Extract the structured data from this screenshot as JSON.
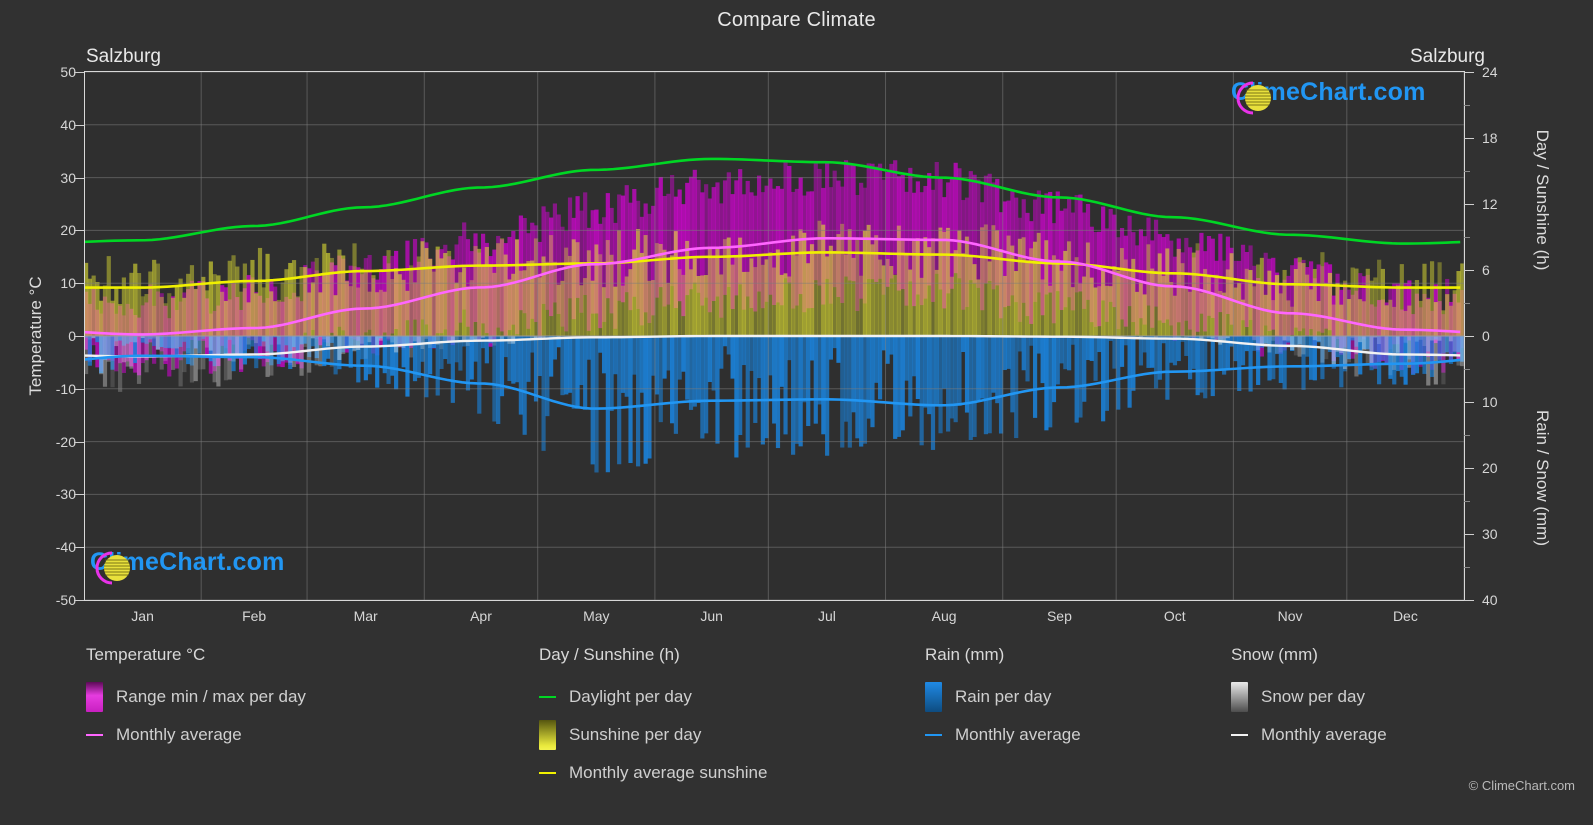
{
  "header": {
    "title": "Compare Climate",
    "location_left": "Salzburg",
    "location_right": "Salzburg"
  },
  "watermark": {
    "text": "ClimeChart.com",
    "brand_blue": "#2196f3",
    "ring_color": "#e832e8",
    "globe_color": "#e8e03c"
  },
  "copyright": "© ClimeChart.com",
  "axes": {
    "left_label": "Temperature °C",
    "right_label_top": "Day / Sunshine (h)",
    "right_label_bottom": "Rain / Snow (mm)",
    "left_ticks": [
      "50",
      "40",
      "30",
      "20",
      "10",
      "0",
      "-10",
      "-20",
      "-30",
      "-40",
      "-50"
    ],
    "right_ticks_top": [
      "24",
      "18",
      "12",
      "6",
      "0"
    ],
    "right_ticks_bottom": [
      "10",
      "20",
      "30",
      "40"
    ],
    "x_ticks": [
      "Jan",
      "Feb",
      "Mar",
      "Apr",
      "May",
      "Jun",
      "Jul",
      "Aug",
      "Sep",
      "Oct",
      "Nov",
      "Dec"
    ]
  },
  "legend": {
    "groups": [
      {
        "title": "Temperature °C",
        "items": [
          {
            "type": "swatch",
            "label": "Range min / max per day",
            "color": "#e000e0"
          },
          {
            "type": "line",
            "label": "Monthly average",
            "color": "#ff66ff"
          }
        ]
      },
      {
        "title": "Day / Sunshine (h)",
        "items": [
          {
            "type": "line",
            "label": "Daylight per day",
            "color": "#00d724"
          },
          {
            "type": "swatch",
            "label": "Sunshine per day",
            "color": "#eaea33"
          },
          {
            "type": "line",
            "label": "Monthly average sunshine",
            "color": "#f0f000"
          }
        ]
      },
      {
        "title": "Rain (mm)",
        "items": [
          {
            "type": "swatch",
            "label": "Rain per day",
            "color": "#1a85e0"
          },
          {
            "type": "line",
            "label": "Monthly average",
            "color": "#2196f3"
          }
        ]
      },
      {
        "title": "Snow (mm)",
        "items": [
          {
            "type": "swatch",
            "label": "Snow per day",
            "color": "#f2f2f2"
          },
          {
            "type": "line",
            "label": "Monthly average",
            "color": "#f2f2f2"
          }
        ]
      }
    ]
  },
  "chart_data": {
    "type": "line",
    "title": "Compare Climate",
    "subtitle": "Salzburg",
    "xlabel": "",
    "ylabel": "Temperature °C",
    "ylabel_right_top": "Day / Sunshine (h)",
    "ylabel_right_bottom": "Rain / Snow (mm)",
    "categories": [
      "Jan",
      "Feb",
      "Mar",
      "Apr",
      "May",
      "Jun",
      "Jul",
      "Aug",
      "Sep",
      "Oct",
      "Nov",
      "Dec"
    ],
    "temp_axis": {
      "min": -50,
      "max": 50,
      "step": 10,
      "unit": "°C"
    },
    "day_axis": {
      "min": 0,
      "max": 24,
      "step": 6,
      "unit": "h",
      "maps_to_temp": [
        0,
        50
      ]
    },
    "rain_axis": {
      "min": 0,
      "max": 40,
      "step": 10,
      "unit": "mm",
      "maps_to_temp": [
        0,
        -50
      ]
    },
    "grid": true,
    "legend_position": "below",
    "series": [
      {
        "name": "Daylight per day",
        "unit": "h",
        "color": "#00d724",
        "values": [
          8.7,
          10.0,
          11.7,
          13.5,
          15.1,
          16.1,
          15.8,
          14.4,
          12.6,
          10.8,
          9.2,
          8.4
        ]
      },
      {
        "name": "Monthly average sunshine",
        "unit": "h",
        "color": "#f0f000",
        "values": [
          4.4,
          5.0,
          5.9,
          6.4,
          6.6,
          7.2,
          7.6,
          7.4,
          6.6,
          5.7,
          4.7,
          4.4
        ]
      },
      {
        "name": "Monthly average temperature",
        "unit": "°C",
        "color": "#ff66ff",
        "values": [
          0.3,
          1.5,
          5.2,
          9.2,
          13.6,
          16.7,
          18.5,
          18.2,
          14.1,
          9.4,
          4.3,
          1.2
        ]
      },
      {
        "name": "Monthly average rain",
        "unit": "mm",
        "color": "#2196f3",
        "values": [
          3.0,
          3.2,
          4.5,
          7.2,
          11.0,
          9.8,
          9.6,
          10.5,
          7.8,
          5.4,
          4.6,
          4.2
        ]
      },
      {
        "name": "Monthly average snow",
        "unit": "mm",
        "color": "#f2f2f2",
        "values": [
          3.1,
          2.8,
          1.6,
          0.7,
          0.2,
          0.0,
          0.0,
          0.0,
          0.1,
          0.4,
          1.5,
          2.8
        ]
      }
    ],
    "daily_bands": [
      {
        "name": "Range min / max per day",
        "kind": "temperature-range",
        "color": "#e000e0"
      },
      {
        "name": "Sunshine per day",
        "kind": "sunshine-hours",
        "color": "#eaea33"
      },
      {
        "name": "Rain per day",
        "kind": "rain-mm",
        "color": "#1a85e0"
      },
      {
        "name": "Snow per day",
        "kind": "snow-mm",
        "color": "#f2f2f2"
      }
    ]
  }
}
